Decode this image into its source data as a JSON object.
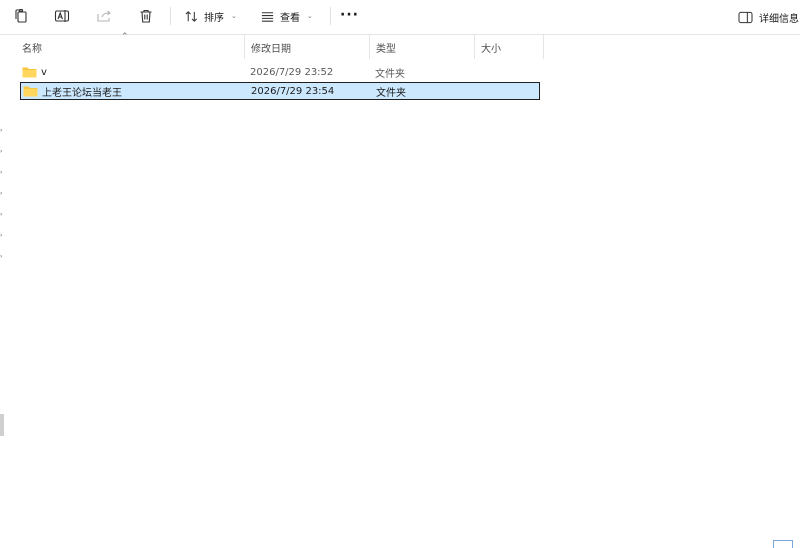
{
  "toolbar": {
    "icons": [
      "copy-icon",
      "rename-icon",
      "share-icon",
      "delete-icon"
    ],
    "sort_label": "排序",
    "view_label": "查看",
    "more_label": "···",
    "details_label": "详细信息"
  },
  "columns": {
    "name": "名称",
    "date": "修改日期",
    "type": "类型",
    "size": "大小"
  },
  "files": [
    {
      "name": "v",
      "date": "2026/7/29 23:52",
      "type": "文件夹",
      "selected": false
    },
    {
      "name": "上老王论坛当老王",
      "date": "2026/7/29 23:54",
      "type": "文件夹",
      "selected": true
    }
  ],
  "colors": {
    "selection_bg": "#cce8ff",
    "folder_yellow": "#f8c63d"
  }
}
